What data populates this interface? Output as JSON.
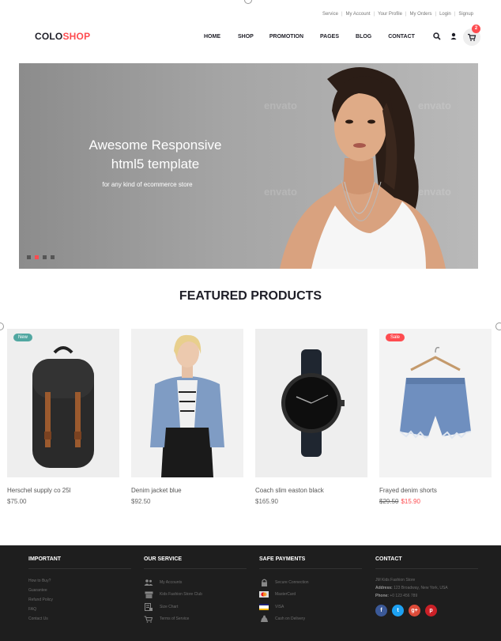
{
  "utility_links": [
    "Service",
    "My Account",
    "Your Profile",
    "My Orders",
    "Login",
    "Signup"
  ],
  "logo": {
    "part1": "COLO",
    "part2": "SHOP"
  },
  "nav": [
    "HOME",
    "SHOP",
    "PROMOTION",
    "PAGES",
    "BLOG",
    "CONTACT"
  ],
  "header": {
    "cart_count": "2",
    "search_icon": "search-icon",
    "user_icon": "user-icon",
    "cart_icon": "cart-icon"
  },
  "hero": {
    "title_line1": "Awesome Responsive",
    "title_line2": "html5 template",
    "subtitle": "for any kind of ecommerce store",
    "watermark": "envato",
    "slides": 4,
    "active_slide": 2
  },
  "featured": {
    "title": "FEATURED PRODUCTS"
  },
  "products": [
    {
      "name": "Herschel supply co 25l",
      "price": "$75.00",
      "badge": "New"
    },
    {
      "name": "Denim jacket blue",
      "price": "$92.50",
      "badge": ""
    },
    {
      "name": "Coach slim easton black",
      "price": "$165.90",
      "badge": ""
    },
    {
      "name": "Frayed denim shorts",
      "old_price": "$29.50",
      "price": "$15.90",
      "badge": "Sale"
    }
  ],
  "footer": {
    "important": {
      "title": "IMPORTANT",
      "links": [
        "How to Buy?",
        "Guarantee",
        "Refund Policy",
        "FAQ",
        "Contact Us"
      ]
    },
    "service": {
      "title": "OUR SERVICE",
      "links": [
        "My Accounts",
        "Kids Fashion Store Club",
        "Size Chart",
        "Terms of Service"
      ]
    },
    "payments": {
      "title": "SAFE PAYMENTS",
      "links": [
        "Secure Connection",
        "MasterCard",
        "VISA",
        "Cash on Delivery"
      ]
    },
    "contact": {
      "title": "CONTACT",
      "store": "JM Kids Fashion Store",
      "address_label": "Address:",
      "address": "123 Broadway, New York, USA",
      "phone_label": "Phone:",
      "phone": "+0 123 456 789",
      "social": [
        "f",
        "t",
        "g+",
        "p"
      ]
    }
  },
  "colors": {
    "accent": "#fe4c50",
    "new_badge": "#51a7a1",
    "footer_bg": "#1e1e1e",
    "facebook": "#3b5998",
    "twitter": "#1da1f2",
    "google": "#dd4b39",
    "pinterest": "#cb2027"
  }
}
